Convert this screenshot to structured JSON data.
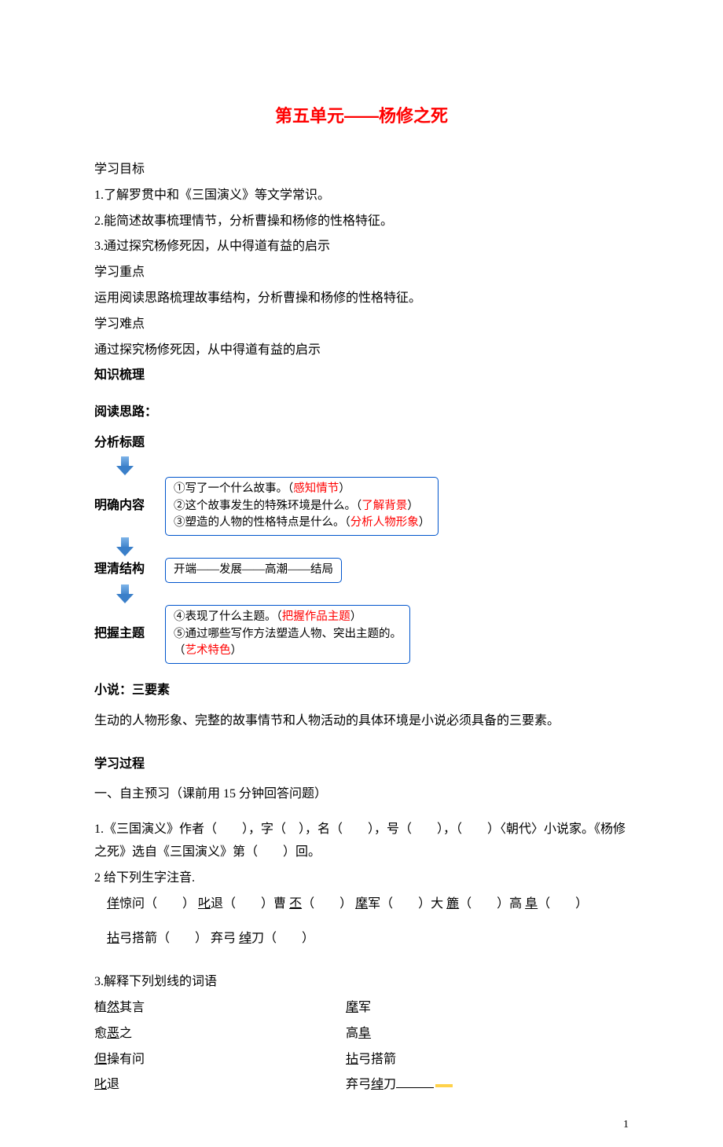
{
  "title": "第五单元——杨修之死",
  "goals_heading": "学习目标",
  "goals": [
    "1.了解罗贯中和《三国演义》等文学常识。",
    "2.能简述故事梳理情节，分析曹操和杨修的性格特征。",
    "3.通过探究杨修死因，从中得道有益的启示"
  ],
  "focus_heading": "学习重点",
  "focus": "运用阅读思路梳理故事结构，分析曹操和杨修的性格特征。",
  "difficulty_heading": "学习难点",
  "difficulty": "通过探究杨修死因，从中得道有益的启示",
  "knowledge_heading": "知识梳理",
  "reading_heading": "阅读思路：",
  "diagram": {
    "step1": "分析标题",
    "step2": "明确内容",
    "box2": {
      "l1a": "①写了一个什么故事。（",
      "l1b": "感知情节",
      "l1c": "）",
      "l2a": "②这个故事发生的特殊环境是什么。（",
      "l2b": "了解背景",
      "l2c": "）",
      "l3a": "③塑造的人物的性格特点是什么。（",
      "l3b": "分析人物形象",
      "l3c": "）"
    },
    "step3": "理清结构",
    "box3": "开端——发展——高潮——结局",
    "step4": "把握主题",
    "box4": {
      "l1a": "④表现了什么主题。（",
      "l1b": "把握作品主题",
      "l1c": "）",
      "l2": "⑤通过哪些写作方法塑造人物、突出主题的。",
      "l3a": "（",
      "l3b": "艺术特色",
      "l3c": "）"
    }
  },
  "novel_heading": "小说：三要素",
  "novel_body": "生动的人物形象、完整的故事情节和人物活动的具体环境是小说必须具备的三要素。",
  "process_heading": "学习过程",
  "preview_heading": "一、自主预习（课前用 15 分钟回答问题）",
  "q1": "1.《三国演义》作者（　　），字（　），名（　　），号（　　），（　　）〈朝代〉小说家。《杨修之死》选自《三国演义》第（　　）回。",
  "q2_heading": "2 给下列生字注音.",
  "q2_line1": {
    "a1": "佯",
    "a1t": "惊问（　　） ",
    "a2": "叱",
    "a2t": "退（　　）曹",
    "a3": "丕",
    "a3t": "（　　）",
    "a4": "麾",
    "a4t": "军（　　）大",
    "a5": "簏",
    "a5t": "（　　）高",
    "a6": "阜",
    "a6t": "（　　）"
  },
  "q2_line2": {
    "b1": "拈",
    "b1t": "弓搭箭（　　） 弃弓",
    "b2": "绰",
    "b2t": "刀（　　）"
  },
  "q3_heading": "3.解释下列划线的词语",
  "q3": {
    "l1a": "植",
    "l1b": "然",
    "l1c": "其言",
    "r1a": "麾",
    "r1b": "军",
    "l2a": "愈",
    "l2b": "恶",
    "l2c": "之",
    "r2a": "高",
    "r2b": "阜",
    "l3a": "但",
    "l3b": "操有问",
    "r3a": "拈",
    "r3b": "弓搭箭",
    "l4a": "叱",
    "l4b": "退",
    "r4a": "弃弓",
    "r4b": "绰",
    "r4c": "刀"
  },
  "page_num": "1"
}
